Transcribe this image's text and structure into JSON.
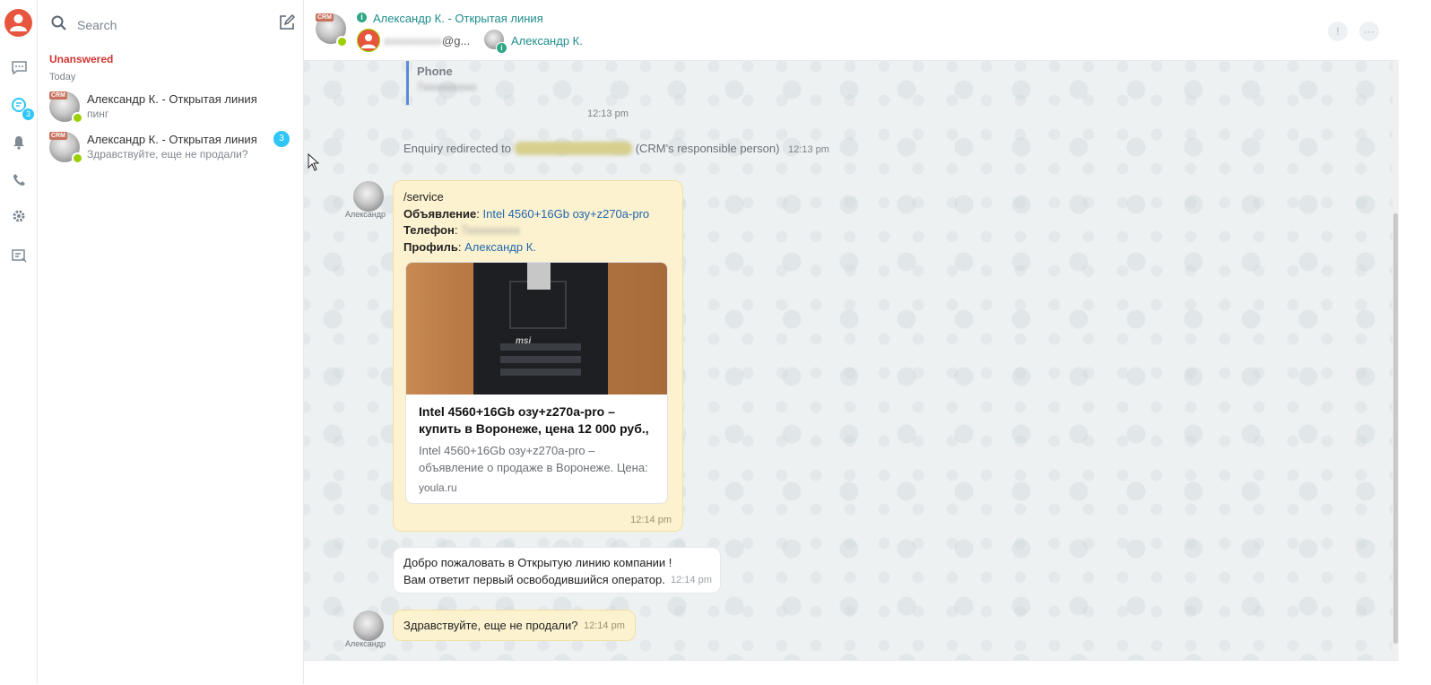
{
  "rail": {
    "badge": "3",
    "icons": [
      "user-avatar-icon",
      "chat-icon",
      "open-lines-icon",
      "bell-icon",
      "phone-icon",
      "gear-icon",
      "notes-icon"
    ]
  },
  "search": {
    "placeholder": "Search"
  },
  "recent": {
    "section_title": "Unanswered",
    "date_label": "Today",
    "items": [
      {
        "crm": "CRM",
        "name": "Александр К. - Открытая линия",
        "message": "пинг",
        "count": ""
      },
      {
        "crm": "CRM",
        "name": "Александр К. - Открытая линия",
        "message": "Здравствуйте, еще не продали?",
        "count": "3"
      }
    ]
  },
  "header": {
    "crm": "CRM",
    "info_glyph": "i",
    "title": "Александр К. - Открытая линия",
    "responsible_email_hidden": "xxxxxxxxxx",
    "responsible_email_suffix": "@g...",
    "operator_name": "Александр К.",
    "alert_glyph": "!",
    "more_glyph": "···"
  },
  "chat": {
    "quote": {
      "label": "Phone",
      "value": "7xxxxxxxxxx",
      "time": "12:13 pm"
    },
    "system": {
      "prefix": "Enquiry redirected to",
      "hidden": "xxxxxxxxxxxxxxxxxxx",
      "suffix": "(CRM's responsible person)",
      "time": "12:13 pm"
    },
    "message1": {
      "author": "Александр",
      "command": "/service",
      "ad_label": "Объявление",
      "ad_link": "Intel 4560+16Gb озу+z270a-pro",
      "phone_label": "Телефон",
      "phone_hidden": "7xxxxxxxxx",
      "profile_label": "Профиль",
      "profile_link": "Александр К.",
      "card": {
        "image_brand": "msi",
        "title": "Intel 4560+16Gb озу+z270a-pro – купить в Воронеже, цена 12 000 руб.,",
        "description": "Intel 4560+16Gb озу+z270a-pro – объявление о продаже в Воронеже. Цена:",
        "site": "youla.ru"
      },
      "time": "12:14 pm"
    },
    "message2": {
      "line1": "Добро пожаловать в Открытую линию компании !",
      "line2": "Вам ответит первый освободившийся оператор.",
      "time": "12:14 pm"
    },
    "message3": {
      "author": "Александр",
      "text": "Здравствуйте, еще не продали?",
      "time": "12:14 pm"
    }
  }
}
